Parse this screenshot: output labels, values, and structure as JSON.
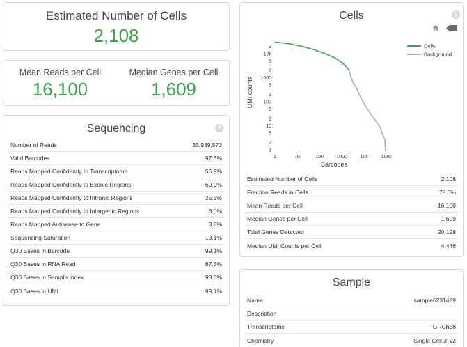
{
  "estimated": {
    "title": "Estimated Number of Cells",
    "value": "2,108"
  },
  "reads": {
    "mean_title": "Mean Reads per Cell",
    "mean_value": "16,100",
    "median_title": "Median Genes per Cell",
    "median_value": "1,609"
  },
  "sequencing": {
    "title": "Sequencing",
    "rows": [
      {
        "label": "Number of Reads",
        "value": "33,939,573"
      },
      {
        "label": "Valid Barcodes",
        "value": "97.6%"
      },
      {
        "label": "Reads Mapped Confidently to Transcriptome",
        "value": "56.9%"
      },
      {
        "label": "Reads Mapped Confidently to Exonic Regions",
        "value": "60.9%"
      },
      {
        "label": "Reads Mapped Confidently to Intronic Regions",
        "value": "25.6%"
      },
      {
        "label": "Reads Mapped Confidently to Intergenic Regions",
        "value": "6.0%"
      },
      {
        "label": "Reads Mapped Antisense to Gene",
        "value": "3.8%"
      },
      {
        "label": "Sequencing Saturation",
        "value": "13.1%"
      },
      {
        "label": "Q30 Bases in Barcode",
        "value": "99.1%"
      },
      {
        "label": "Q30 Bases in RNA Read",
        "value": "87.5%"
      },
      {
        "label": "Q30 Bases in Sample Index",
        "value": "98.8%"
      },
      {
        "label": "Q30 Bases in UMI",
        "value": "99.1%"
      }
    ]
  },
  "cells": {
    "title": "Cells",
    "rows": [
      {
        "label": "Estimated Number of Cells",
        "value": "2,108"
      },
      {
        "label": "Fraction Reads in Cells",
        "value": "78.0%"
      },
      {
        "label": "Mean Reads per Cell",
        "value": "16,100"
      },
      {
        "label": "Median Genes per Cell",
        "value": "1,609"
      },
      {
        "label": "Total Genes Detected",
        "value": "20,198"
      },
      {
        "label": "Median UMI Counts per Cell",
        "value": "4,446"
      }
    ]
  },
  "sample": {
    "title": "Sample",
    "rows": [
      {
        "label": "Name",
        "value": "sample6231429"
      },
      {
        "label": "Description",
        "value": ""
      },
      {
        "label": "Transcriptome",
        "value": "GRCh38"
      },
      {
        "label": "Chemistry",
        "value": "Single Cell 3' v2"
      }
    ]
  },
  "icons": {
    "help": "question-circle-icon",
    "home": "home-icon",
    "back": "back-arrow-icon"
  },
  "colors": {
    "accent": "#3ba54a",
    "cells_line": "#3ba54a",
    "background_line": "#b0b0b0"
  },
  "chart_data": {
    "type": "line",
    "title": "",
    "xlabel": "Barcodes",
    "ylabel": "UMI counts",
    "x_scale": "log",
    "y_scale": "log",
    "xlim": [
      1,
      200000
    ],
    "ylim": [
      1,
      60000
    ],
    "x_tick_labels": [
      "1",
      "10",
      "100",
      "1000",
      "10k",
      "100k"
    ],
    "y_tick_labels": [
      "1",
      "2",
      "5",
      "10",
      "2",
      "5",
      "100",
      "2",
      "5",
      "1000",
      "2",
      "5",
      "10k",
      "2"
    ],
    "legend_position": "top-right",
    "series": [
      {
        "name": "Cells",
        "color": "#3ba54a",
        "x": [
          1,
          2,
          5,
          10,
          20,
          50,
          100,
          200,
          500,
          1000,
          1500,
          2108
        ],
        "y": [
          30000,
          28000,
          25000,
          22000,
          19000,
          15000,
          12000,
          9500,
          6500,
          4200,
          3000,
          2000
        ]
      },
      {
        "name": "Background",
        "color": "#b0b0b0",
        "x": [
          2108,
          2500,
          3000,
          4000,
          5000,
          6000,
          8000,
          10000,
          15000,
          20000,
          30000,
          40000,
          50000,
          60000,
          70000,
          80000,
          85000,
          86000,
          88000,
          90000,
          100000
        ],
        "y": [
          2000,
          1100,
          700,
          450,
          300,
          200,
          120,
          80,
          45,
          30,
          18,
          12,
          9,
          6,
          4,
          3,
          2.5,
          2,
          1.2,
          1,
          1
        ]
      }
    ]
  }
}
